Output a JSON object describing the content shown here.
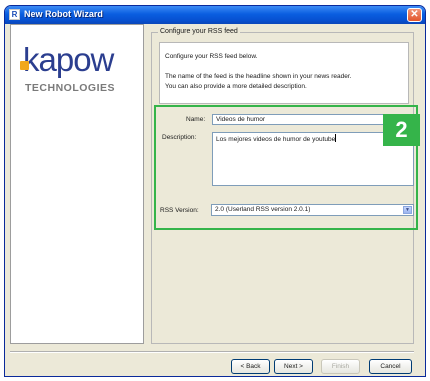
{
  "window": {
    "title": "New Robot Wizard",
    "app_icon_letter": "R"
  },
  "sidebar": {
    "logo_word": "kapow",
    "logo_sub": "TECHNOLOGIES"
  },
  "section": {
    "legend": "Configure your RSS feed",
    "intro_line1": "Configure your RSS feed below.",
    "intro_line2": "The name of the feed is the headline shown in your news reader.",
    "intro_line3": "You can also provide a more detailed description."
  },
  "form": {
    "name_label": "Name:",
    "name_value": "Videos de humor",
    "description_label": "Description:",
    "description_value": "Los mejores videos de humor de youtube",
    "rss_version_label": "RSS Version:",
    "rss_version_value": "2.0 (Userland RSS version 2.0.1)"
  },
  "annotation": {
    "badge": "2",
    "color": "#35b44a"
  },
  "buttons": {
    "back": "< Back",
    "next": "Next >",
    "finish": "Finish",
    "cancel": "Cancel"
  },
  "colors": {
    "titlebar": "#0a5ee0",
    "close": "#e2562c",
    "logo_text": "#2b3e8f",
    "logo_accent": "#f2a81d"
  }
}
